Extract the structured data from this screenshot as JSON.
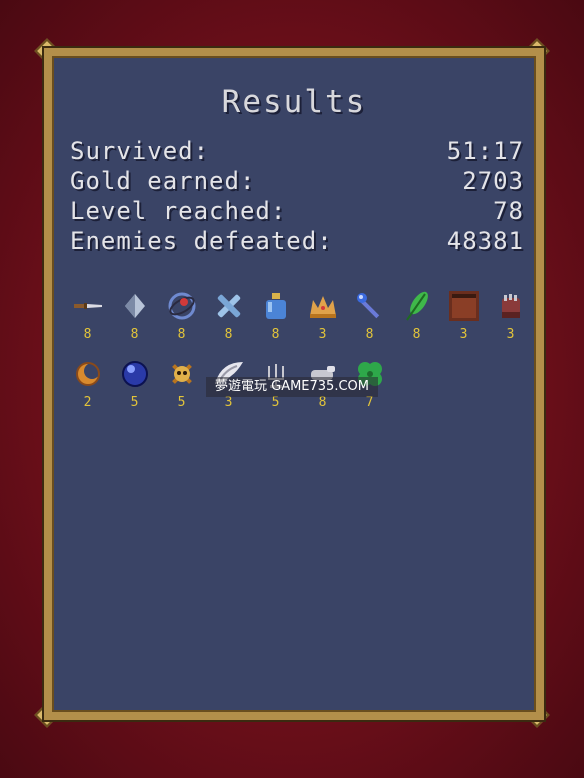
{
  "results": {
    "title": "Results",
    "stats": [
      {
        "label": "Survived:",
        "value": "51:17"
      },
      {
        "label": "Gold earned:",
        "value": "2703"
      },
      {
        "label": "Level reached:",
        "value": "78"
      },
      {
        "label": "Enemies defeated:",
        "value": "48381"
      }
    ]
  },
  "items": [
    {
      "icon": "knife-icon",
      "level": "8"
    },
    {
      "icon": "crystal-icon",
      "level": "8"
    },
    {
      "icon": "orbit-ring-icon",
      "level": "8"
    },
    {
      "icon": "cross-icon",
      "level": "8"
    },
    {
      "icon": "bottle-icon",
      "level": "8"
    },
    {
      "icon": "crown-icon",
      "level": "3"
    },
    {
      "icon": "wand-icon",
      "level": "8"
    },
    {
      "icon": "feather-icon",
      "level": "8"
    },
    {
      "icon": "tome-icon",
      "level": "3"
    },
    {
      "icon": "gauntlet-icon",
      "level": "3"
    },
    {
      "icon": "moon-pendant-icon",
      "level": "2"
    },
    {
      "icon": "orb-icon",
      "level": "5"
    },
    {
      "icon": "skull-icon",
      "level": "5"
    },
    {
      "icon": "wings-icon",
      "level": "3"
    },
    {
      "icon": "candelabra-icon",
      "level": "5"
    },
    {
      "icon": "hand-icon",
      "level": "8"
    },
    {
      "icon": "clover-icon",
      "level": "7"
    }
  ],
  "watermark": "夢遊電玩 GAME735.COM",
  "colors": {
    "panel": "#3a4466",
    "frame": "#b38f4a",
    "level_text": "#e2c43a",
    "background": "#6e0f1a"
  }
}
